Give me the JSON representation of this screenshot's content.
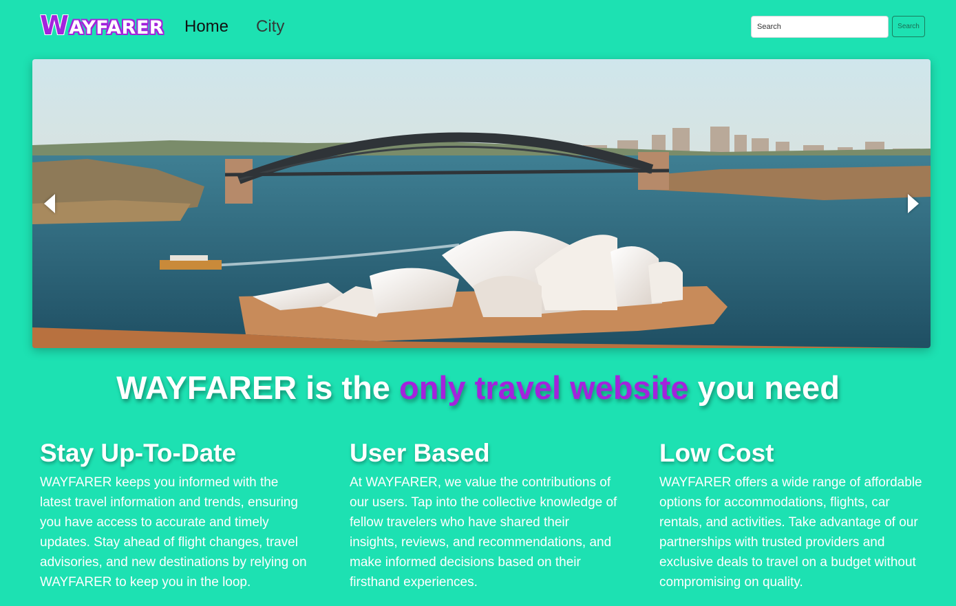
{
  "nav": {
    "logo_first": "W",
    "logo_rest": "AYFARER",
    "links": [
      "Home",
      "City"
    ],
    "search_placeholder": "Search",
    "search_button": "Search"
  },
  "carousel": {
    "image": "Sydney Harbour Bridge and Sydney Opera House aerial view",
    "prev_icon": "chevron-left-icon",
    "next_icon": "chevron-right-icon"
  },
  "headline": {
    "part1": "WAYFARER is the ",
    "accent": "only travel website",
    "part2": " you need"
  },
  "features": [
    {
      "title": "Stay Up-To-Date",
      "text": "WAYFARER keeps you informed with the latest travel information and trends, ensuring you have access to accurate and timely updates. Stay ahead of flight changes, travel advisories, and new destinations by relying on WAYFARER to keep you in the loop."
    },
    {
      "title": "User Based",
      "text": "At WAYFARER, we value the contributions of our users. Tap into the collective knowledge of fellow travelers who have shared their insights, reviews, and recommendations, and make informed decisions based on their firsthand experiences."
    },
    {
      "title": "Low Cost",
      "text": "WAYFARER offers a wide range of affordable options for accommodations, flights, car rentals, and activities. Take advantage of our partnerships with trusted providers and exclusive deals to travel on a budget without compromising on quality."
    }
  ],
  "colors": {
    "background": "#1de1b2",
    "accent": "#a323dc",
    "text": "#ffffff"
  }
}
